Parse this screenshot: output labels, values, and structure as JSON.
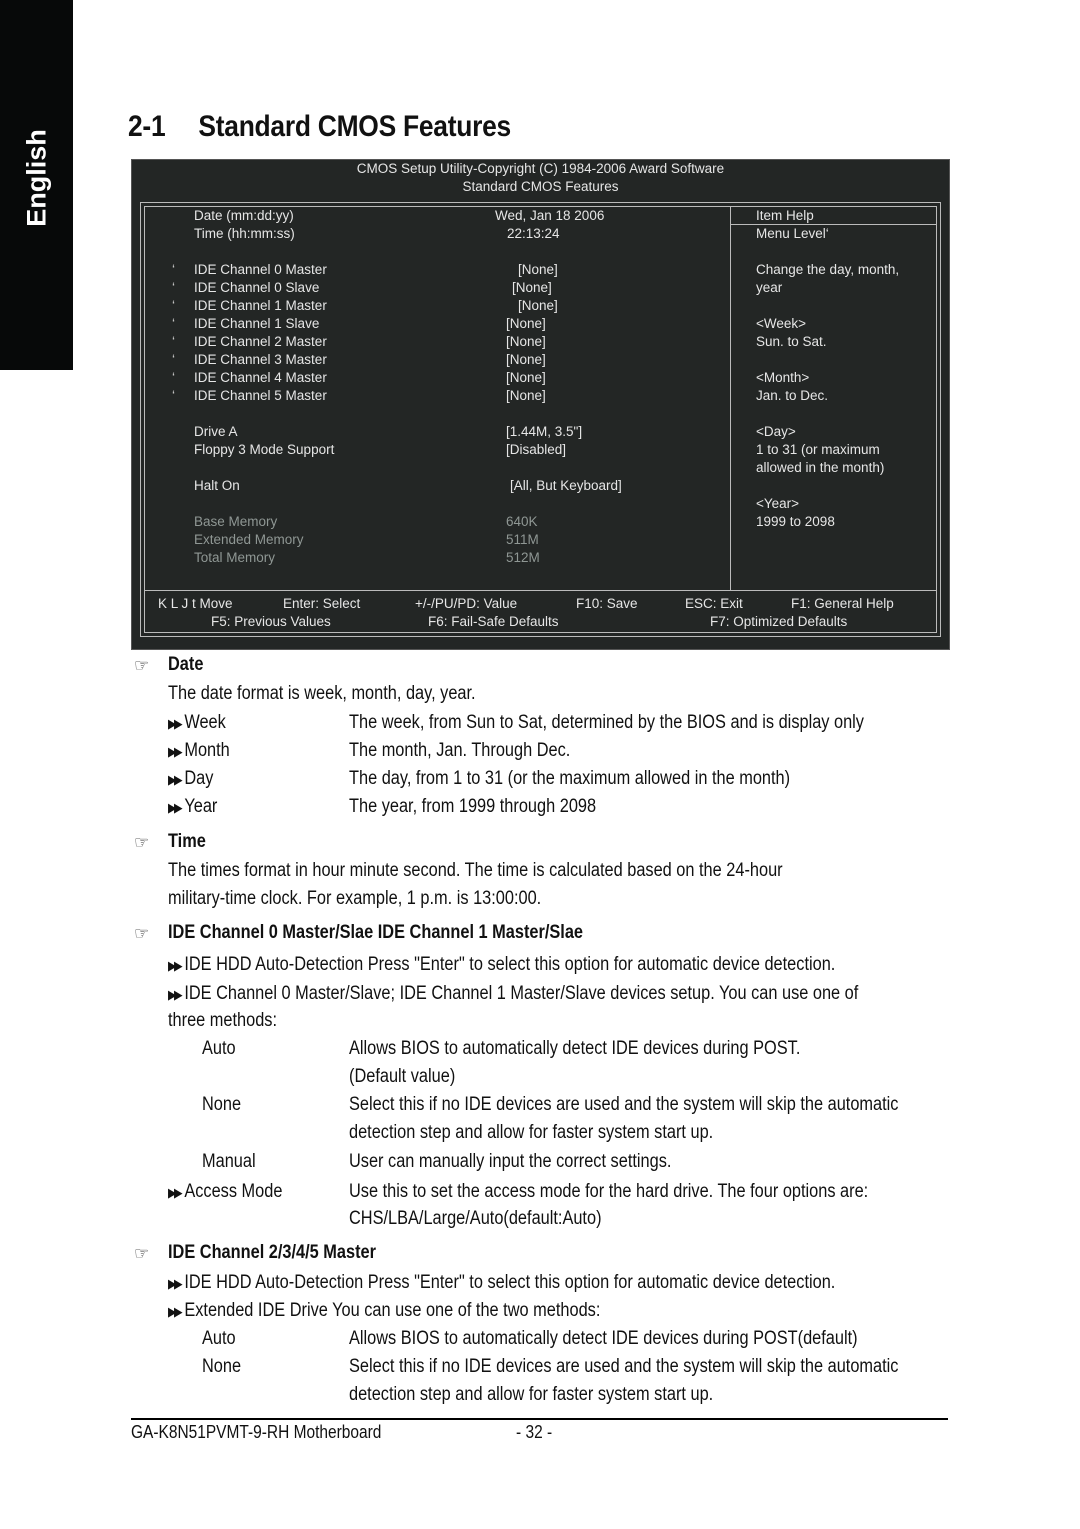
{
  "side_tab": {
    "label": "English"
  },
  "page_title": {
    "number": "2-1",
    "text": "Standard CMOS Features"
  },
  "bios": {
    "header_line1": "CMOS Setup Utility-Copyright (C) 1984-2006 Award Software",
    "header_line2": "Standard CMOS Features",
    "items": [
      {
        "marker": "",
        "label": "Date (mm:dd:yy)",
        "value": "Wed, Jan  18  2006"
      },
      {
        "marker": "",
        "label": "Time (hh:mm:ss)",
        "value": "22:13:24"
      },
      {
        "marker": "‘",
        "label": "IDE Channel 0 Master",
        "value": "[None]"
      },
      {
        "marker": "‘",
        "label": "IDE Channel 0 Slave",
        "value": "[None]"
      },
      {
        "marker": "‘",
        "label": "IDE Channel 1 Master",
        "value": "[None]"
      },
      {
        "marker": "‘",
        "label": "IDE Channel 1 Slave",
        "value": "[None]"
      },
      {
        "marker": "‘",
        "label": "IDE Channel 2 Master",
        "value": "[None]"
      },
      {
        "marker": "‘",
        "label": "IDE Channel 3 Master",
        "value": "[None]"
      },
      {
        "marker": "‘",
        "label": "IDE Channel 4 Master",
        "value": "[None]"
      },
      {
        "marker": "‘",
        "label": "IDE Channel 5 Master",
        "value": "[None]"
      },
      {
        "marker": "",
        "label": "Drive A",
        "value": "[1.44M, 3.5\"]"
      },
      {
        "marker": "",
        "label": "Floppy 3 Mode Support",
        "value": "[Disabled]"
      },
      {
        "marker": "",
        "label": "Halt On",
        "value": "[All, But Keyboard]"
      },
      {
        "marker": "",
        "label": "Base Memory",
        "value": "640K"
      },
      {
        "marker": "",
        "label": "Extended Memory",
        "value": "511M"
      },
      {
        "marker": "",
        "label": "Total Memory",
        "value": "512M"
      }
    ],
    "help": {
      "title": "Item Help",
      "lines": [
        "Menu Level‘",
        "",
        "Change the day, month,",
        "year",
        "",
        "<Week>",
        "Sun. to Sat.",
        "",
        "<Month>",
        "Jan. to Dec.",
        "",
        "<Day>",
        "1 to 31 (or maximum",
        "allowed in the month)",
        "",
        "<Year>",
        "1999 to 2098"
      ]
    },
    "footer": {
      "move": "K L J t Move",
      "select": "Enter: Select",
      "value": "+/-/PU/PD: Value",
      "save": "F10: Save",
      "exit": "ESC: Exit",
      "general_help": "F1: General Help",
      "previous": "F5: Previous Values",
      "failsafe": "F6: Fail-Safe Defaults",
      "optimized": "F7: Optimized Defaults"
    }
  },
  "sections": {
    "date": {
      "heading": "Date",
      "intro": "The date format is week, month, day, year.",
      "rows": [
        {
          "term": "Week",
          "desc": "The week, from Sun to Sat, determined by the BIOS and is display only"
        },
        {
          "term": "Month",
          "desc": "The month, Jan. Through Dec."
        },
        {
          "term": "Day",
          "desc": "The day, from 1 to 31 (or the maximum allowed in the month)"
        },
        {
          "term": "Year",
          "desc": "The year, from 1999 through 2098"
        }
      ]
    },
    "time": {
      "heading": "Time",
      "line1": "The times format in hour minute second. The time is calculated based on the 24-hour",
      "line2": "military-time clock. For example, 1 p.m. is 13:00:00."
    },
    "ide01": {
      "heading": "IDE Channel 0 Master/Slae IDE Channel 1 Master/Slae",
      "bullet1": "IDE HDD Auto-Detection Press \"Enter\" to select this option for automatic device detection.",
      "bullet2": "IDE Channel 0 Master/Slave; IDE Channel 1 Master/Slave devices setup.  You can use one of",
      "bullet2_cont": "three methods:",
      "auto_term": "Auto",
      "auto_desc1": "Allows BIOS to automatically detect IDE devices during POST.",
      "auto_desc2": "(Default value)",
      "none_term": "None",
      "none_desc1": "Select this if no IDE devices are used and the system will skip the automatic",
      "none_desc2": "detection step and allow for faster system start up.",
      "manual_term": "Manual",
      "manual_desc": "User can manually input the correct settings.",
      "access_term": "Access Mode",
      "access_desc1": "Use this to set the access mode for the hard drive. The four options are:",
      "access_desc2": "CHS/LBA/Large/Auto(default:Auto)"
    },
    "ide2345": {
      "heading": "IDE Channel 2/3/4/5 Master",
      "bullet1": "IDE HDD Auto-Detection Press \"Enter\" to select this option for automatic device detection.",
      "bullet2": "Extended IDE Drive You can use one of the two methods:",
      "auto_term": "Auto",
      "auto_desc": "Allows BIOS to automatically detect IDE devices during POST(default)",
      "none_term": "None",
      "none_desc1": "Select this if no IDE devices are used and the system will skip the automatic",
      "none_desc2": "detection step and allow for faster system start up."
    }
  },
  "footer": {
    "model": "GA-K8N51PVMT-9-RH Motherboard",
    "page": "- 32 -"
  },
  "icons": {
    "section": "☞",
    "bullet": "▶▶"
  }
}
